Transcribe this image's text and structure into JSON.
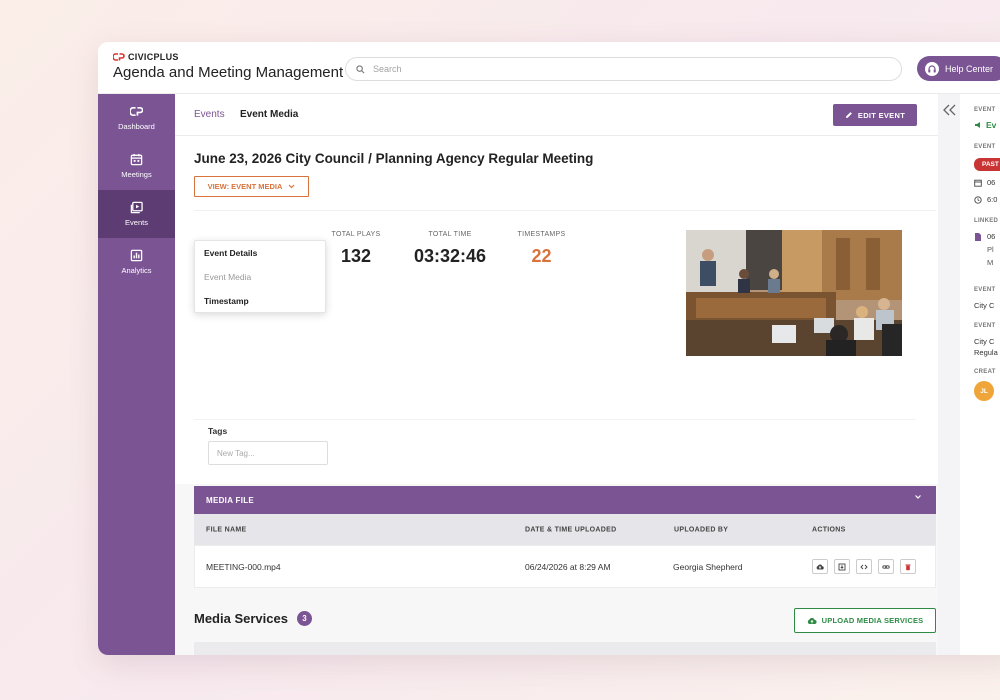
{
  "brand": {
    "name": "CIVICPLUS",
    "app_title": "Agenda and Meeting Management"
  },
  "search": {
    "placeholder": "Search"
  },
  "help": {
    "label": "Help Center"
  },
  "sidebar": {
    "items": [
      {
        "label": "Dashboard",
        "icon": "dashboard-icon"
      },
      {
        "label": "Meetings",
        "icon": "calendar-icon"
      },
      {
        "label": "Events",
        "icon": "media-icon",
        "active": true
      },
      {
        "label": "Analytics",
        "icon": "chart-icon"
      }
    ]
  },
  "breadcrumb": {
    "parent": "Events",
    "current": "Event Media"
  },
  "edit_button": {
    "label": "EDIT EVENT"
  },
  "event": {
    "title": "June 23, 2026 City Council / Planning Agency Regular Meeting"
  },
  "view_button": {
    "label": "VIEW: EVENT MEDIA"
  },
  "dropdown": {
    "items": [
      {
        "label": "Event Details"
      },
      {
        "label": "Event Media"
      },
      {
        "label": "Timestamp"
      }
    ]
  },
  "stats": {
    "total_plays": {
      "label": "TOTAL PLAYS",
      "value": "132"
    },
    "total_time": {
      "label": "TOTAL TIME",
      "value": "03:32:46"
    },
    "timestamps": {
      "label": "TIMESTAMPS",
      "value": "22"
    }
  },
  "tags": {
    "label": "Tags",
    "placeholder": "New Tag..."
  },
  "media_file": {
    "title": "MEDIA FILE",
    "columns": [
      "FILE NAME",
      "DATE & TIME UPLOADED",
      "UPLOADED BY",
      "ACTIONS"
    ],
    "rows": [
      {
        "file_name": "MEETING-000.mp4",
        "uploaded_at": "06/24/2026 at 8:29 AM",
        "uploaded_by": "Georgia Shepherd"
      }
    ]
  },
  "media_services": {
    "title": "Media Services",
    "count": "3",
    "upload_label": "UPLOAD MEDIA SERVICES"
  },
  "right_panel": {
    "event_label": "EVENT",
    "event_value": "Ev",
    "status_label": "EVENT",
    "status_badge": "PAST",
    "date_value": "06",
    "time_value": "6:0",
    "linked_label": "LINKED",
    "linked_lines": [
      "06",
      "Pl",
      "M"
    ],
    "event_name_label": "EVENT",
    "event_name_value": "City C",
    "event_desc_label": "EVENT",
    "event_desc_lines": [
      "City C",
      "Regula"
    ],
    "created_label": "CREAT",
    "avatar_initials": "JL"
  },
  "colors": {
    "brand_purple": "#7b5494",
    "sidebar_active": "#5d3c73",
    "accent_orange": "#d9733e",
    "success_green": "#2e8b46",
    "danger_red": "#c93535"
  }
}
